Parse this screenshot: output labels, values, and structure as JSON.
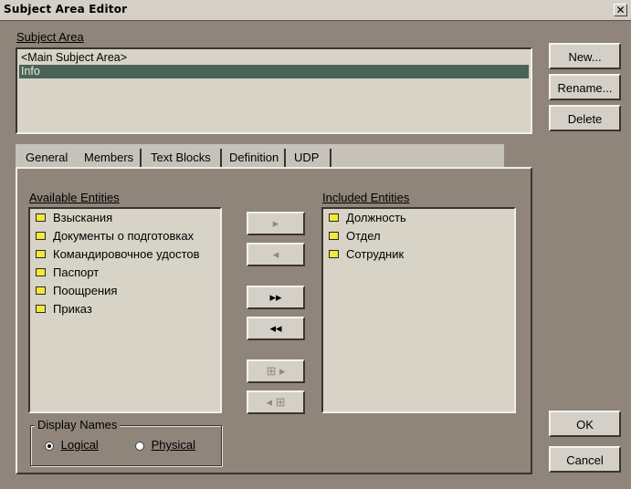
{
  "window": {
    "title": "Subject Area Editor",
    "close_glyph": "✕"
  },
  "subject_area": {
    "label": "Subject Area",
    "items": [
      {
        "text": "<Main Subject Area>",
        "selected": false
      },
      {
        "text": "Info",
        "selected": true
      }
    ]
  },
  "side_buttons": {
    "new": "New...",
    "rename": "Rename...",
    "delete": "Delete"
  },
  "tabs": [
    "General",
    "Members",
    "Text Blocks",
    "Definition",
    "UDP"
  ],
  "available": {
    "label": "Available Entities",
    "items": [
      "Взыскания",
      "Документы о подготовках",
      "Командировочное удостов",
      "Паспорт",
      "Поощрения",
      "Приказ"
    ]
  },
  "included": {
    "label": "Included Entities",
    "items": [
      "Должность",
      "Отдел",
      "Сотрудник"
    ]
  },
  "move_buttons": {
    "add_one": "▸",
    "remove_one": "◂",
    "add_all": "▸▸",
    "remove_all": "◂◂",
    "add_tree": "⊞ ▸",
    "remove_tree": "◂ ⊞"
  },
  "display_names": {
    "label": "Display Names",
    "logical": "Logical",
    "physical": "Physical",
    "selected": "logical"
  },
  "footer": {
    "ok": "OK",
    "cancel": "Cancel"
  },
  "colors": {
    "background": "#8f857b",
    "selection": "#4a6356",
    "entity_icon": "#f4e83a"
  }
}
